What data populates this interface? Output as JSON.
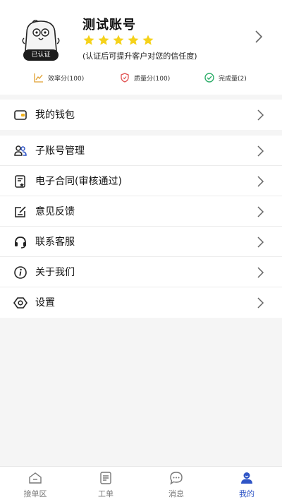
{
  "profile": {
    "name": "测试账号",
    "badge": "已认证",
    "hint": "(认证后可提升客户对您的信任度)",
    "star_count": 5,
    "star_color": "#f5d21a"
  },
  "stats": [
    {
      "label": "效率分(100)",
      "icon": "chart-icon",
      "color": "#e0a030"
    },
    {
      "label": "质量分(100)",
      "icon": "shield-icon",
      "color": "#e05050"
    },
    {
      "label": "完成量(2)",
      "icon": "check-circle-icon",
      "color": "#2eae6a"
    }
  ],
  "menu_group1": [
    {
      "label": "我的钱包",
      "icon": "wallet-icon"
    }
  ],
  "menu_group2": [
    {
      "label": "子账号管理",
      "icon": "users-icon"
    },
    {
      "label": "电子合同(审核通过)",
      "icon": "contract-icon"
    },
    {
      "label": "意见反馈",
      "icon": "feedback-icon"
    },
    {
      "label": "联系客服",
      "icon": "headset-icon"
    },
    {
      "label": "关于我们",
      "icon": "info-icon"
    },
    {
      "label": "设置",
      "icon": "settings-icon"
    }
  ],
  "tabs": [
    {
      "label": "接单区",
      "icon": "home-icon"
    },
    {
      "label": "工单",
      "icon": "order-icon"
    },
    {
      "label": "消息",
      "icon": "message-icon"
    },
    {
      "label": "我的",
      "icon": "profile-icon",
      "active": true
    }
  ],
  "colors": {
    "accent": "#2f55c6",
    "wallet_accent": "#f2b21c"
  }
}
